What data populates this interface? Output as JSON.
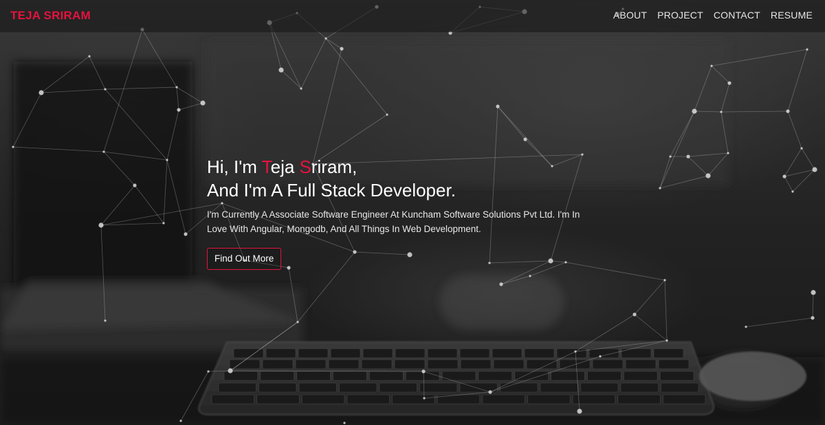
{
  "navbar": {
    "brand": "TEJA SRIRAM",
    "links": [
      {
        "label": "ABOUT"
      },
      {
        "label": "PROJECT"
      },
      {
        "label": "CONTACT"
      },
      {
        "label": "RESUME"
      }
    ]
  },
  "hero": {
    "greeting_prefix": "Hi, I'm ",
    "first_initial": "T",
    "first_rest": "eja ",
    "last_initial": "S",
    "last_rest": "riram,",
    "headline_line2": "And I'm A Full Stack Developer.",
    "description_line1": "I'm Currently A Associate Software Engineer At Kuncham Software Solutions Pvt Ltd. I'm In",
    "description_line2": "Love With Angular, Mongodb, And All Things In Web Development.",
    "cta_label": "Find Out More"
  },
  "colors": {
    "accent": "#e5133e",
    "nav_text": "#e6e6e6",
    "background": "#222222"
  }
}
